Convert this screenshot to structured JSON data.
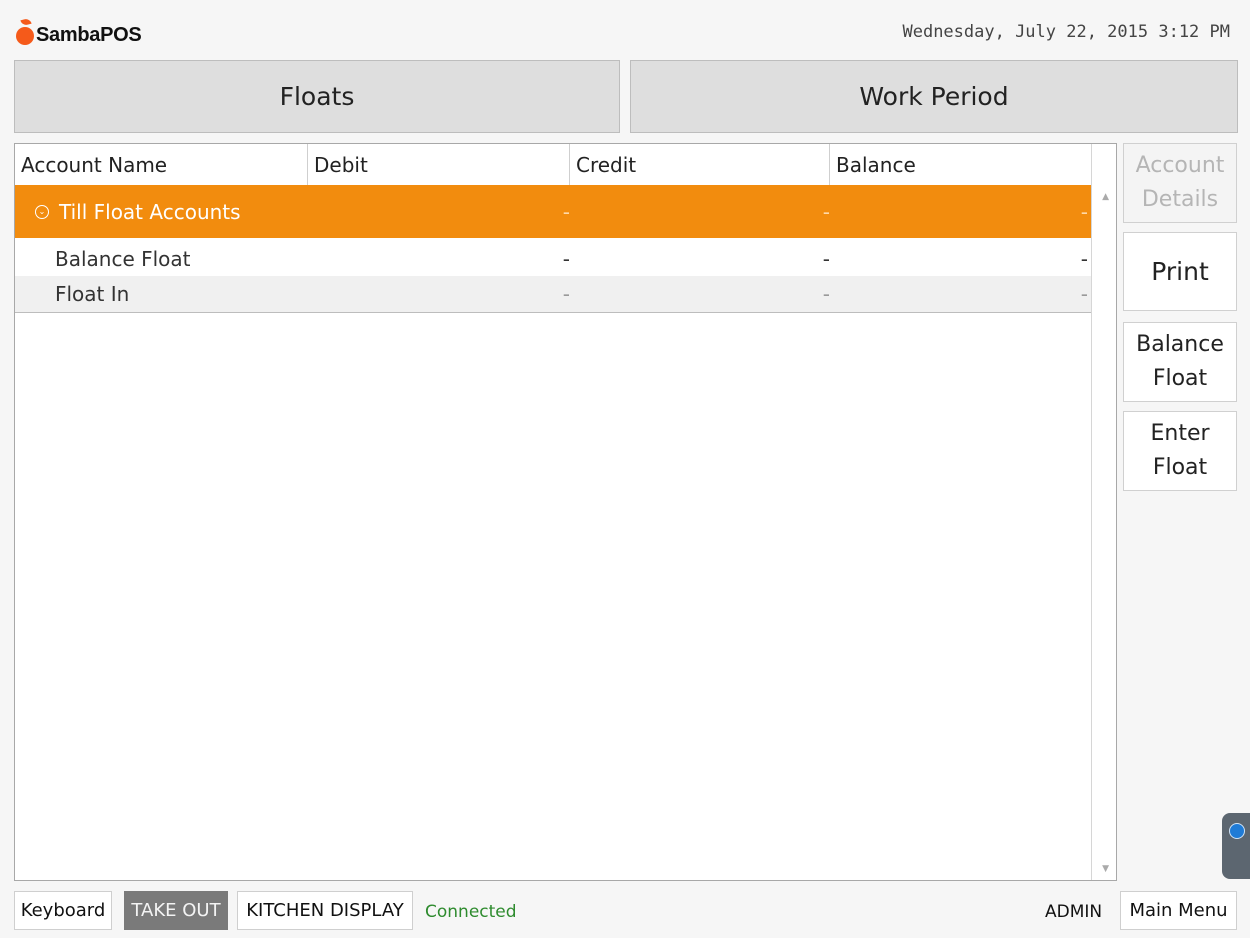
{
  "app": {
    "brand": "SambaPOS",
    "datetime": "Wednesday, July 22, 2015 3:12 PM"
  },
  "top_tabs": [
    {
      "label": "Floats"
    },
    {
      "label": "Work Period"
    }
  ],
  "grid": {
    "columns": [
      "Account Name",
      "Debit",
      "Credit",
      "Balance"
    ],
    "group": {
      "name": "Till Float Accounts",
      "debit": "-",
      "credit": "-",
      "balance": "-",
      "color": "#f28c0e"
    },
    "rows": [
      {
        "name": "Balance Float",
        "debit": "-",
        "credit": "-",
        "balance": "-"
      },
      {
        "name": "Float In",
        "debit": "-",
        "credit": "-",
        "balance": "-"
      }
    ]
  },
  "side_buttons": {
    "account_details": [
      "Account",
      "Details"
    ],
    "print": "Print",
    "balance_float": [
      "Balance",
      "Float"
    ],
    "enter_float": [
      "Enter",
      "Float"
    ]
  },
  "footer": {
    "keyboard": "Keyboard",
    "take_out": "TAKE OUT",
    "kitchen_display": "KITCHEN DISPLAY",
    "status": "Connected",
    "user": "ADMIN",
    "main_menu": "Main Menu"
  },
  "icons": {
    "logo": "apple-logo-icon",
    "group_toggle": "collapse-circle-icon",
    "remote_tab": "teamviewer-icon"
  }
}
